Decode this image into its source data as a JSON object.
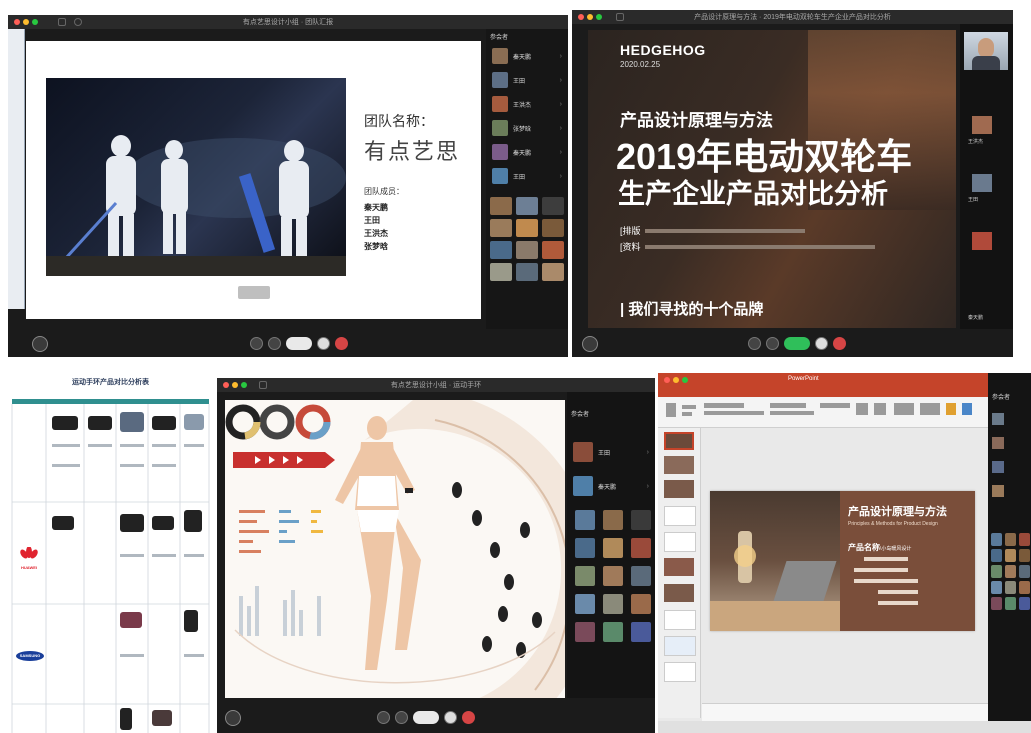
{
  "panel1": {
    "window_title": "有点艺思设计小组 · 团队汇报",
    "slide": {
      "team_label": "团队名称：",
      "team_name": "有点艺思",
      "members_label": "团队成员：",
      "members": [
        "秦天鹏",
        "王田",
        "王洪杰",
        "张梦晗"
      ]
    },
    "side_header": "参会者",
    "participants": [
      {
        "name": "秦天鹏",
        "color": "#8a6d53"
      },
      {
        "name": "王田",
        "color": "#5d6f86"
      },
      {
        "name": "王洪杰",
        "color": "#a55b3e"
      },
      {
        "name": "张梦晗",
        "color": "#6b7d5a"
      },
      {
        "name": "秦天鹏",
        "color": "#7b5c8a"
      },
      {
        "name": "王田",
        "color": "#4f7fa8"
      }
    ]
  },
  "panel2": {
    "window_title": "产品设计原理与方法 · 2019年电动双轮车生产企业产品对比分析",
    "slide": {
      "brand": "HEDGEHOG",
      "date": "2020.02.25",
      "course": "产品设计原理与方法",
      "title_line1": "2019年电动双轮车",
      "title_line2": "生产企业产品对比分析",
      "meta1": "[排版",
      "meta2": "[资料",
      "bottom": "| 我们寻找的十个品牌"
    },
    "side_names": [
      "王洪杰",
      "王田",
      "秦天鹏"
    ]
  },
  "panel3": {
    "doc_title": "运动手环产品对比分析表",
    "brands": [
      "HUAWEI",
      "SAMSUNG"
    ]
  },
  "panel4": {
    "window_title": "有点艺思设计小组 · 运动手环",
    "side_header": "参会者",
    "participants": [
      {
        "name": "王田",
        "color": "#8a4d3a"
      },
      {
        "name": "秦天鹏",
        "color": "#4f7fa8"
      }
    ]
  },
  "panel5": {
    "app_title": "PowerPoint",
    "slide": {
      "course": "产品设计原理与方法",
      "course_en": "Principles & Methods for Product Design",
      "product_label": "产品名称",
      "product_value": "\\小岛暖风设计"
    },
    "side_header": "参会者"
  }
}
